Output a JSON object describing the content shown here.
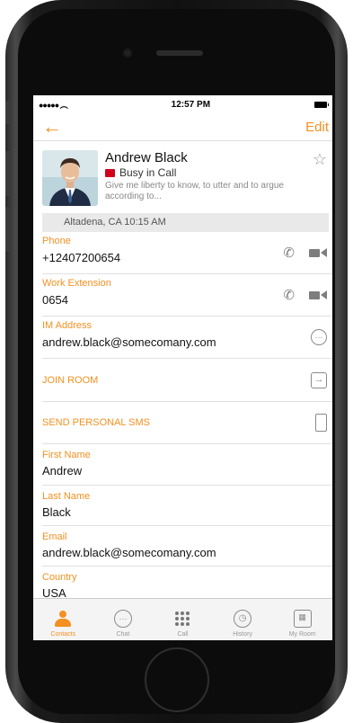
{
  "status": {
    "signal": "●●●●● ",
    "time": "12:57 PM"
  },
  "nav": {
    "edit": "Edit"
  },
  "profile": {
    "name": "Andrew Black",
    "status": "Busy in Call",
    "mood": "Give me liberty to know, to utter and to argue according to..."
  },
  "location": "Altadena, CA 10:15 AM",
  "fields": {
    "phone": {
      "label": "Phone",
      "value": "+12407200654"
    },
    "work": {
      "label": "Work Extension",
      "value": "0654"
    },
    "im": {
      "label": "IM Address",
      "value": "andrew.black@somecomany.com"
    },
    "join_room": "JOIN ROOM",
    "send_sms": "SEND PERSONAL SMS",
    "first_name": {
      "label": "First Name",
      "value": "Andrew"
    },
    "last_name": {
      "label": "Last Name",
      "value": "Black"
    },
    "email": {
      "label": "Email",
      "value": "andrew.black@somecomany.com"
    },
    "country": {
      "label": "Country",
      "value": "USA"
    }
  },
  "tabs": [
    "Contacts",
    "Chat",
    "Call",
    "History",
    "My Room"
  ],
  "colors": {
    "accent": "#f39021",
    "busy": "#d0021b"
  }
}
